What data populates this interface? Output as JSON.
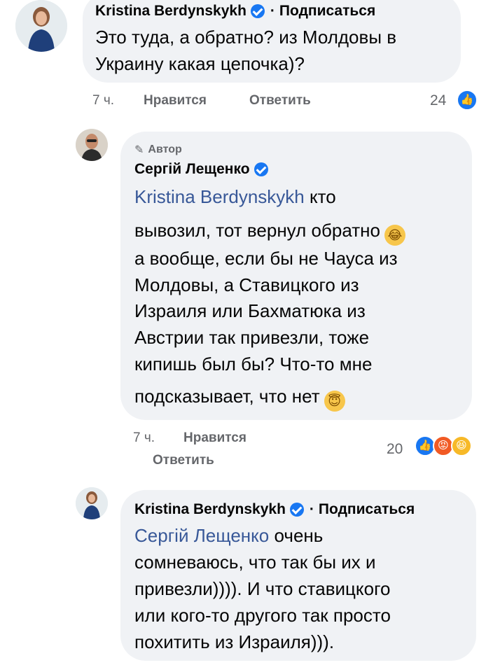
{
  "comment1": {
    "author": "Kristina Berdynskykh",
    "separator": "·",
    "follow": "Подписаться",
    "text_lines": [
      "Это туда, а обратно? из Молдовы в",
      "Украину какая цепочка)?"
    ],
    "time": "7 ч.",
    "like": "Нравится",
    "reply": "Ответить",
    "reactions_count": "24",
    "reaction_icons": [
      "like-icon"
    ]
  },
  "comment2": {
    "badge": "Автор",
    "author": "Сергій Лещенко",
    "mention": "Kristina Berdynskykh",
    "text_first": "кто",
    "text_lines": [
      "вывозил, тот вернул обратно",
      "а вообще, если бы не Чауса из",
      "Молдовы, а Ставицкого из",
      "Израиля или Бахматюка из",
      "Австрии так привезли, тоже",
      "кипишь был бы? Что-то мне",
      "подсказывает, что нет"
    ],
    "emoji_laugh": "😂",
    "emoji_angel": "😇",
    "time": "7 ч.",
    "like": "Нравится",
    "reply": "Ответить",
    "reactions_count": "20",
    "reaction_icons": [
      "like-icon",
      "angry-icon",
      "haha-icon"
    ]
  },
  "comment3": {
    "author": "Kristina Berdynskykh",
    "separator": "·",
    "follow": "Подписаться",
    "mention": "Сергій Лещенко",
    "text_first": "очень",
    "text_lines": [
      "сомневаюсь, что так бы их и",
      "привезли)))). И что ставицкого",
      "или кого-то другого так просто",
      "похитить из Израиля)))."
    ]
  }
}
